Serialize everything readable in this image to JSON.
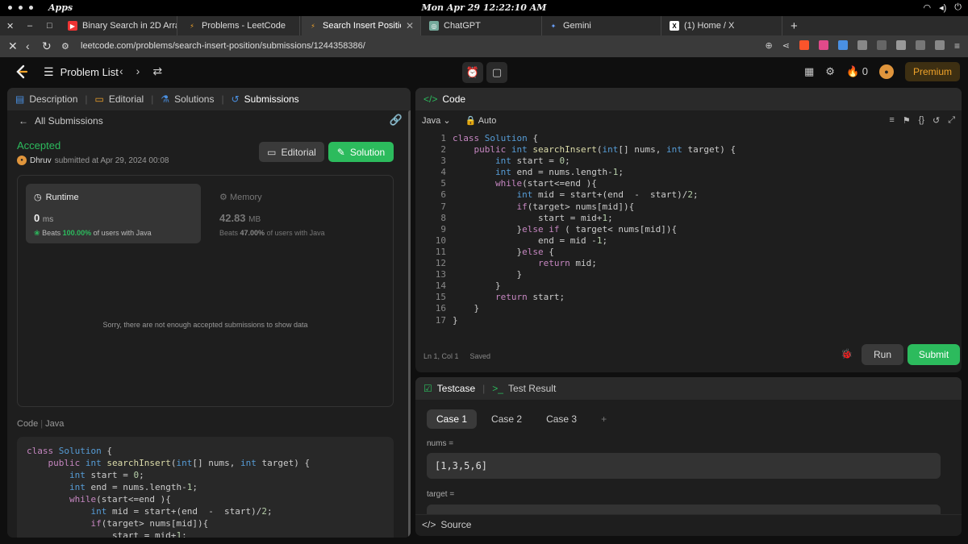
{
  "system": {
    "apps_label": "Apps",
    "clock": "Mon Apr 29  12:22:10 AM"
  },
  "tabs": [
    {
      "title": "Binary Search in 2D Arra",
      "favicon": "youtube-icon",
      "color": "#e33"
    },
    {
      "title": "Problems - LeetCode",
      "favicon": "leetcode-icon",
      "color": "#f0a32a"
    },
    {
      "title": "Search Insert Position",
      "favicon": "leetcode-icon",
      "color": "#f0a32a"
    },
    {
      "title": "ChatGPT",
      "favicon": "chatgpt-icon",
      "color": "#74aa9c"
    },
    {
      "title": "Gemini",
      "favicon": "gemini-icon",
      "color": "#6aa1ff"
    },
    {
      "title": "(1) Home / X",
      "favicon": "x-icon",
      "color": "#fff"
    }
  ],
  "browser": {
    "url": "leetcode.com/problems/search-insert-position/submissions/1244358386/"
  },
  "lc_header": {
    "problem_list": "Problem List",
    "streak": "0",
    "premium": "Premium"
  },
  "left_tabs": {
    "description": "Description",
    "editorial": "Editorial",
    "solutions": "Solutions",
    "submissions": "Submissions"
  },
  "submission": {
    "back_label": "All Submissions",
    "status": "Accepted",
    "user": "Dhruv",
    "submitted_text": "submitted at Apr 29, 2024 00:08",
    "editorial_btn": "Editorial",
    "solution_btn": "Solution",
    "runtime": {
      "label": "Runtime",
      "value": "0",
      "unit": "ms",
      "beats_prefix": "Beats",
      "beats": "100.00%",
      "beats_suffix": "of users with Java"
    },
    "memory": {
      "label": "Memory",
      "value": "42.83",
      "unit": "MB",
      "beats_prefix": "Beats",
      "beats": "47.00%",
      "beats_suffix": "of users with Java"
    },
    "no_data": "Sorry, there are not enough accepted submissions to show data",
    "code_label": "Code",
    "code_lang": "Java"
  },
  "code_panel": {
    "title": "Code",
    "language": "Java",
    "mode": "Auto",
    "cursor": "Ln 1, Col 1",
    "saved": "Saved",
    "run": "Run",
    "submit": "Submit"
  },
  "code_lines": [
    "class Solution {",
    "    public int searchInsert(int[] nums, int target) {",
    "        int start = 0;",
    "        int end = nums.length-1;",
    "        while(start<=end ){",
    "            int mid = start+(end  -  start)/2;",
    "            if(target> nums[mid]){",
    "                start = mid+1;",
    "            }else if ( target< nums[mid]){",
    "                end = mid -1;",
    "            }else {",
    "                return mid;",
    "            }",
    "        }",
    "        return start;",
    "    }",
    "}"
  ],
  "testcase": {
    "tab": "Testcase",
    "result_tab": "Test Result",
    "cases": [
      "Case 1",
      "Case 2",
      "Case 3"
    ],
    "nums_label": "nums =",
    "nums_value": "[1,3,5,6]",
    "target_label": "target =",
    "source": "Source"
  }
}
